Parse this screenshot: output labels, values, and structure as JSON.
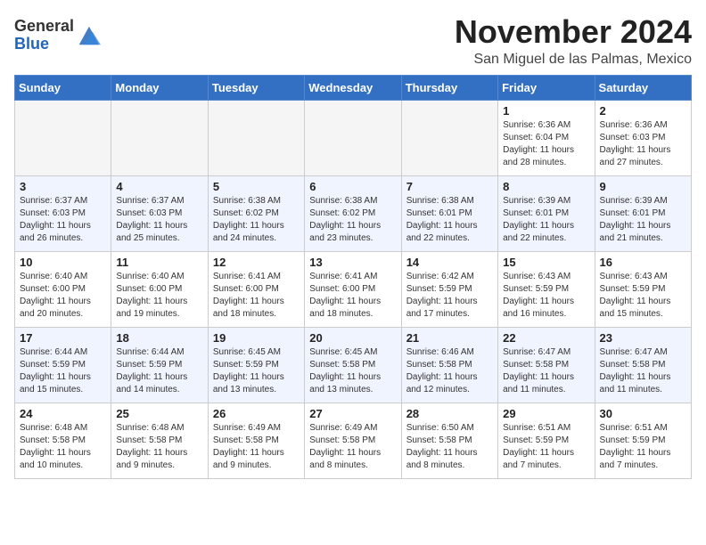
{
  "header": {
    "logo_general": "General",
    "logo_blue": "Blue",
    "month_title": "November 2024",
    "location": "San Miguel de las Palmas, Mexico"
  },
  "weekdays": [
    "Sunday",
    "Monday",
    "Tuesday",
    "Wednesday",
    "Thursday",
    "Friday",
    "Saturday"
  ],
  "weeks": [
    [
      {
        "day": "",
        "info": ""
      },
      {
        "day": "",
        "info": ""
      },
      {
        "day": "",
        "info": ""
      },
      {
        "day": "",
        "info": ""
      },
      {
        "day": "",
        "info": ""
      },
      {
        "day": "1",
        "info": "Sunrise: 6:36 AM\nSunset: 6:04 PM\nDaylight: 11 hours and 28 minutes."
      },
      {
        "day": "2",
        "info": "Sunrise: 6:36 AM\nSunset: 6:03 PM\nDaylight: 11 hours and 27 minutes."
      }
    ],
    [
      {
        "day": "3",
        "info": "Sunrise: 6:37 AM\nSunset: 6:03 PM\nDaylight: 11 hours and 26 minutes."
      },
      {
        "day": "4",
        "info": "Sunrise: 6:37 AM\nSunset: 6:03 PM\nDaylight: 11 hours and 25 minutes."
      },
      {
        "day": "5",
        "info": "Sunrise: 6:38 AM\nSunset: 6:02 PM\nDaylight: 11 hours and 24 minutes."
      },
      {
        "day": "6",
        "info": "Sunrise: 6:38 AM\nSunset: 6:02 PM\nDaylight: 11 hours and 23 minutes."
      },
      {
        "day": "7",
        "info": "Sunrise: 6:38 AM\nSunset: 6:01 PM\nDaylight: 11 hours and 22 minutes."
      },
      {
        "day": "8",
        "info": "Sunrise: 6:39 AM\nSunset: 6:01 PM\nDaylight: 11 hours and 22 minutes."
      },
      {
        "day": "9",
        "info": "Sunrise: 6:39 AM\nSunset: 6:01 PM\nDaylight: 11 hours and 21 minutes."
      }
    ],
    [
      {
        "day": "10",
        "info": "Sunrise: 6:40 AM\nSunset: 6:00 PM\nDaylight: 11 hours and 20 minutes."
      },
      {
        "day": "11",
        "info": "Sunrise: 6:40 AM\nSunset: 6:00 PM\nDaylight: 11 hours and 19 minutes."
      },
      {
        "day": "12",
        "info": "Sunrise: 6:41 AM\nSunset: 6:00 PM\nDaylight: 11 hours and 18 minutes."
      },
      {
        "day": "13",
        "info": "Sunrise: 6:41 AM\nSunset: 6:00 PM\nDaylight: 11 hours and 18 minutes."
      },
      {
        "day": "14",
        "info": "Sunrise: 6:42 AM\nSunset: 5:59 PM\nDaylight: 11 hours and 17 minutes."
      },
      {
        "day": "15",
        "info": "Sunrise: 6:43 AM\nSunset: 5:59 PM\nDaylight: 11 hours and 16 minutes."
      },
      {
        "day": "16",
        "info": "Sunrise: 6:43 AM\nSunset: 5:59 PM\nDaylight: 11 hours and 15 minutes."
      }
    ],
    [
      {
        "day": "17",
        "info": "Sunrise: 6:44 AM\nSunset: 5:59 PM\nDaylight: 11 hours and 15 minutes."
      },
      {
        "day": "18",
        "info": "Sunrise: 6:44 AM\nSunset: 5:59 PM\nDaylight: 11 hours and 14 minutes."
      },
      {
        "day": "19",
        "info": "Sunrise: 6:45 AM\nSunset: 5:59 PM\nDaylight: 11 hours and 13 minutes."
      },
      {
        "day": "20",
        "info": "Sunrise: 6:45 AM\nSunset: 5:58 PM\nDaylight: 11 hours and 13 minutes."
      },
      {
        "day": "21",
        "info": "Sunrise: 6:46 AM\nSunset: 5:58 PM\nDaylight: 11 hours and 12 minutes."
      },
      {
        "day": "22",
        "info": "Sunrise: 6:47 AM\nSunset: 5:58 PM\nDaylight: 11 hours and 11 minutes."
      },
      {
        "day": "23",
        "info": "Sunrise: 6:47 AM\nSunset: 5:58 PM\nDaylight: 11 hours and 11 minutes."
      }
    ],
    [
      {
        "day": "24",
        "info": "Sunrise: 6:48 AM\nSunset: 5:58 PM\nDaylight: 11 hours and 10 minutes."
      },
      {
        "day": "25",
        "info": "Sunrise: 6:48 AM\nSunset: 5:58 PM\nDaylight: 11 hours and 9 minutes."
      },
      {
        "day": "26",
        "info": "Sunrise: 6:49 AM\nSunset: 5:58 PM\nDaylight: 11 hours and 9 minutes."
      },
      {
        "day": "27",
        "info": "Sunrise: 6:49 AM\nSunset: 5:58 PM\nDaylight: 11 hours and 8 minutes."
      },
      {
        "day": "28",
        "info": "Sunrise: 6:50 AM\nSunset: 5:58 PM\nDaylight: 11 hours and 8 minutes."
      },
      {
        "day": "29",
        "info": "Sunrise: 6:51 AM\nSunset: 5:59 PM\nDaylight: 11 hours and 7 minutes."
      },
      {
        "day": "30",
        "info": "Sunrise: 6:51 AM\nSunset: 5:59 PM\nDaylight: 11 hours and 7 minutes."
      }
    ]
  ]
}
